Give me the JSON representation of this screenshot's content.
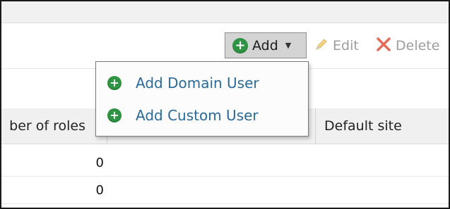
{
  "toolbar": {
    "add_label": "Add",
    "edit_label": "Edit",
    "delete_label": "Delete"
  },
  "add_menu": {
    "items": [
      {
        "label": "Add Domain User"
      },
      {
        "label": "Add Custom User"
      }
    ]
  },
  "table": {
    "columns": {
      "roles": "ber of roles",
      "default_site": "Default site"
    },
    "rows": [
      {
        "roles": "0"
      },
      {
        "roles": "0"
      }
    ]
  },
  "colors": {
    "accent_green": "#2e9444",
    "menu_text": "#2a6a9a",
    "disabled_text": "#9d9d9d"
  },
  "icons": [
    "plus-circle-icon",
    "chevron-down-icon",
    "pencil-icon",
    "x-icon"
  ]
}
